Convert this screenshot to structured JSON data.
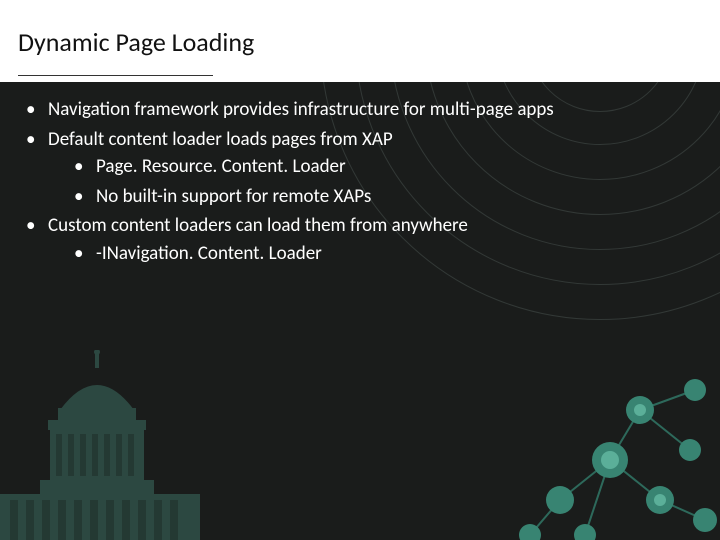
{
  "slide": {
    "title": "Dynamic Page Loading",
    "bullets": [
      {
        "text": "Navigation framework provides infrastructure for multi-page apps"
      },
      {
        "text": "Default content loader loads pages from XAP",
        "children": [
          {
            "text": "Page. Resource. Content. Loader"
          },
          {
            "text": "No built-in support for remote XAPs"
          }
        ]
      },
      {
        "text": "Custom content loaders can load them from anywhere",
        "children": [
          {
            "text": "-INavigation. Content. Loader"
          }
        ]
      }
    ]
  }
}
